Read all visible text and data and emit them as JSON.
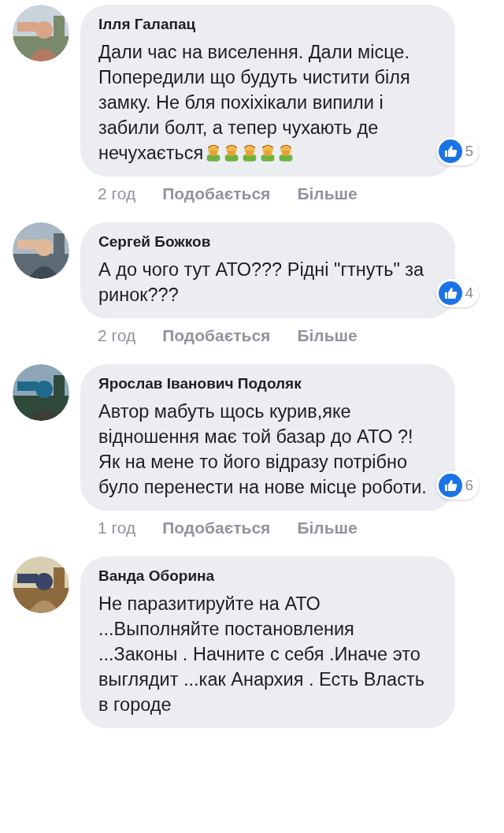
{
  "comments": [
    {
      "author": "Ілля Галапац",
      "text": "Дали час на виселення. Дали місце. Попередили що будуть чистити біля замку. Не бля похіхікали випили і забили болт, а тепер чухають де нечухається",
      "emoji": [
        {
          "kind": "facepalm"
        },
        {
          "kind": "facepalm"
        },
        {
          "kind": "facepalm"
        },
        {
          "kind": "facepalm"
        },
        {
          "kind": "facepalm"
        }
      ],
      "likes": "5",
      "time": "2 год",
      "like_action": "Подобається",
      "more_action": "Більше"
    },
    {
      "author": "Сергей Божков",
      "text": "А до чого тут АТО??? Рідні \"гтнуть\" за ринок???",
      "likes": "4",
      "time": "2 год",
      "like_action": "Подобається",
      "more_action": "Більше"
    },
    {
      "author": "Ярослав Іванович Подоляк",
      "text": "Автор мабуть щось курив,яке відношення має той базар до АТО ?! Як на мене то його відразу потрібно було перенести на нове місце роботи.",
      "likes": "6",
      "time": "1 год",
      "like_action": "Подобається",
      "more_action": "Більше"
    },
    {
      "author": "Ванда Оборина",
      "text": "Не паразитируйте на АТО ...Выполняйте постановления ...Законы . Начните с себя .Иначе это выглядит ...как Анархия . Есть Власть в городе"
    }
  ]
}
